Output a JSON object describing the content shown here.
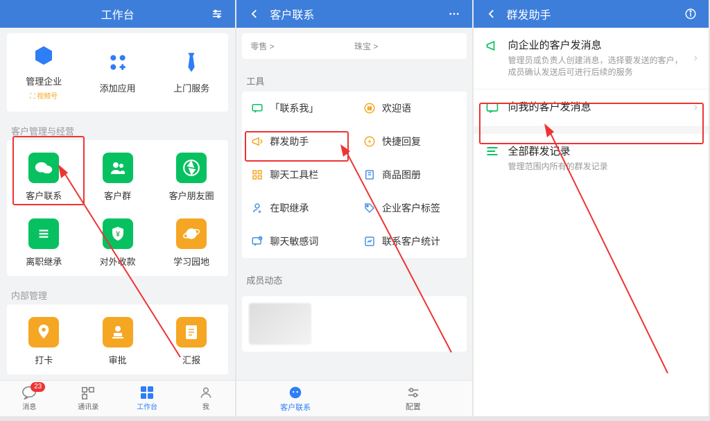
{
  "screen1": {
    "title": "工作台",
    "top_row": [
      {
        "label": "管理企业",
        "sub": "⛶ 视频号"
      },
      {
        "label": "添加应用"
      },
      {
        "label": "上门服务"
      }
    ],
    "section_customer_title": "客户管理与经营",
    "customer_grid": [
      {
        "label": "客户联系"
      },
      {
        "label": "客户群"
      },
      {
        "label": "客户朋友圈"
      },
      {
        "label": "离职继承"
      },
      {
        "label": "对外收款"
      },
      {
        "label": "学习园地"
      }
    ],
    "section_internal_title": "内部管理",
    "internal_grid": [
      {
        "label": "打卡"
      },
      {
        "label": "审批"
      },
      {
        "label": "汇报"
      }
    ],
    "tabs": [
      {
        "label": "消息",
        "badge": "23"
      },
      {
        "label": "通讯录"
      },
      {
        "label": "工作台"
      },
      {
        "label": "我"
      }
    ]
  },
  "screen2": {
    "title": "客户联系",
    "breadcrumb": {
      "left": "零售 >",
      "right": "珠宝 >"
    },
    "tools_title": "工具",
    "tools": [
      {
        "label": "「联系我」"
      },
      {
        "label": "欢迎语"
      },
      {
        "label": "群发助手"
      },
      {
        "label": "快捷回复"
      },
      {
        "label": "聊天工具栏"
      },
      {
        "label": "商品图册"
      },
      {
        "label": "在职继承"
      },
      {
        "label": "企业客户标签"
      },
      {
        "label": "聊天敏感词"
      },
      {
        "label": "联系客户统计"
      }
    ],
    "members_title": "成员动态",
    "tabs": [
      {
        "label": "客户联系"
      },
      {
        "label": "配置"
      }
    ]
  },
  "screen3": {
    "title": "群发助手",
    "items": [
      {
        "title": "向企业的客户发消息",
        "desc": "管理员或负责人创建消息，选择要发送的客户，成员确认发送后可进行后续的服务"
      },
      {
        "title": "向我的客户发消息",
        "desc": ""
      }
    ],
    "records": {
      "title": "全部群发记录",
      "desc": "管理范围内所有的群发记录"
    }
  }
}
